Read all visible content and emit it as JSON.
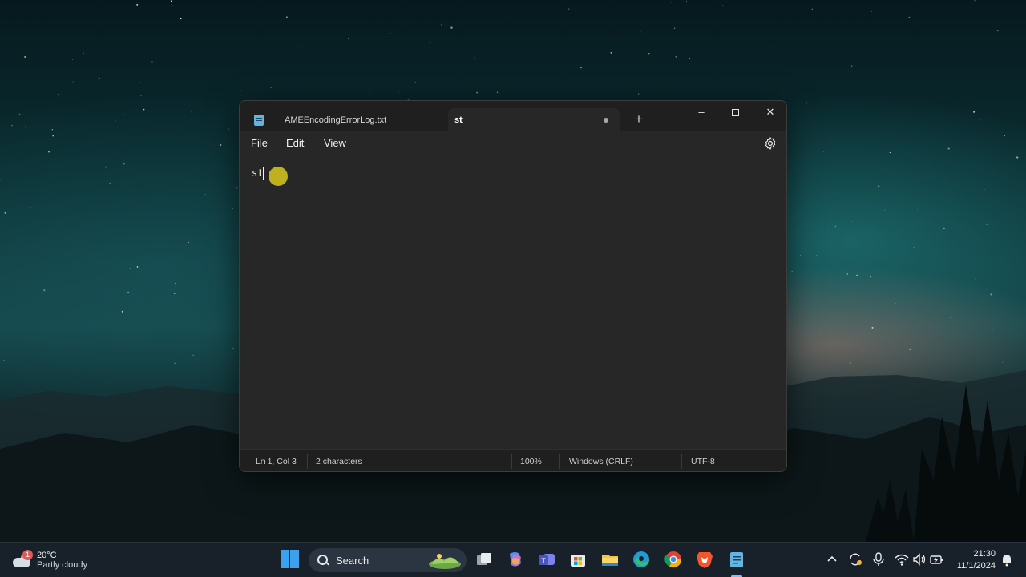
{
  "window": {
    "tabs": [
      {
        "label": "AMEEncodingErrorLog.txt",
        "active": false
      },
      {
        "label": "st",
        "active": true,
        "unsaved": true
      }
    ],
    "new_tab_symbol": "+",
    "controls": {
      "minimize": "–",
      "close": "✕"
    }
  },
  "menu": {
    "items": [
      "File",
      "Edit",
      "View"
    ],
    "settings_icon": "gear-icon"
  },
  "editor": {
    "content": "st"
  },
  "status": {
    "position": "Ln 1, Col 3",
    "characters": "2 characters",
    "zoom": "100%",
    "line_ending": "Windows (CRLF)",
    "encoding": "UTF-8"
  },
  "taskbar": {
    "weather": {
      "temp": "20°C",
      "desc": "Partly cloudy",
      "badge": "1"
    },
    "search_label": "Search",
    "pinned_apps": [
      "task-view-icon",
      "copilot-icon",
      "teams-icon",
      "store-icon",
      "file-explorer-icon",
      "edge-icon",
      "chrome-icon",
      "brave-icon",
      "notepad-icon"
    ],
    "clock": {
      "time": "21:30",
      "date": "11/1/2024"
    }
  },
  "colors": {
    "window_bg": "#272727",
    "titlebar_bg": "#1f1f1f",
    "cursor_highlight": "#c6b81c",
    "taskbar_bg": "#18202a",
    "accent": "#3aa3f0"
  }
}
